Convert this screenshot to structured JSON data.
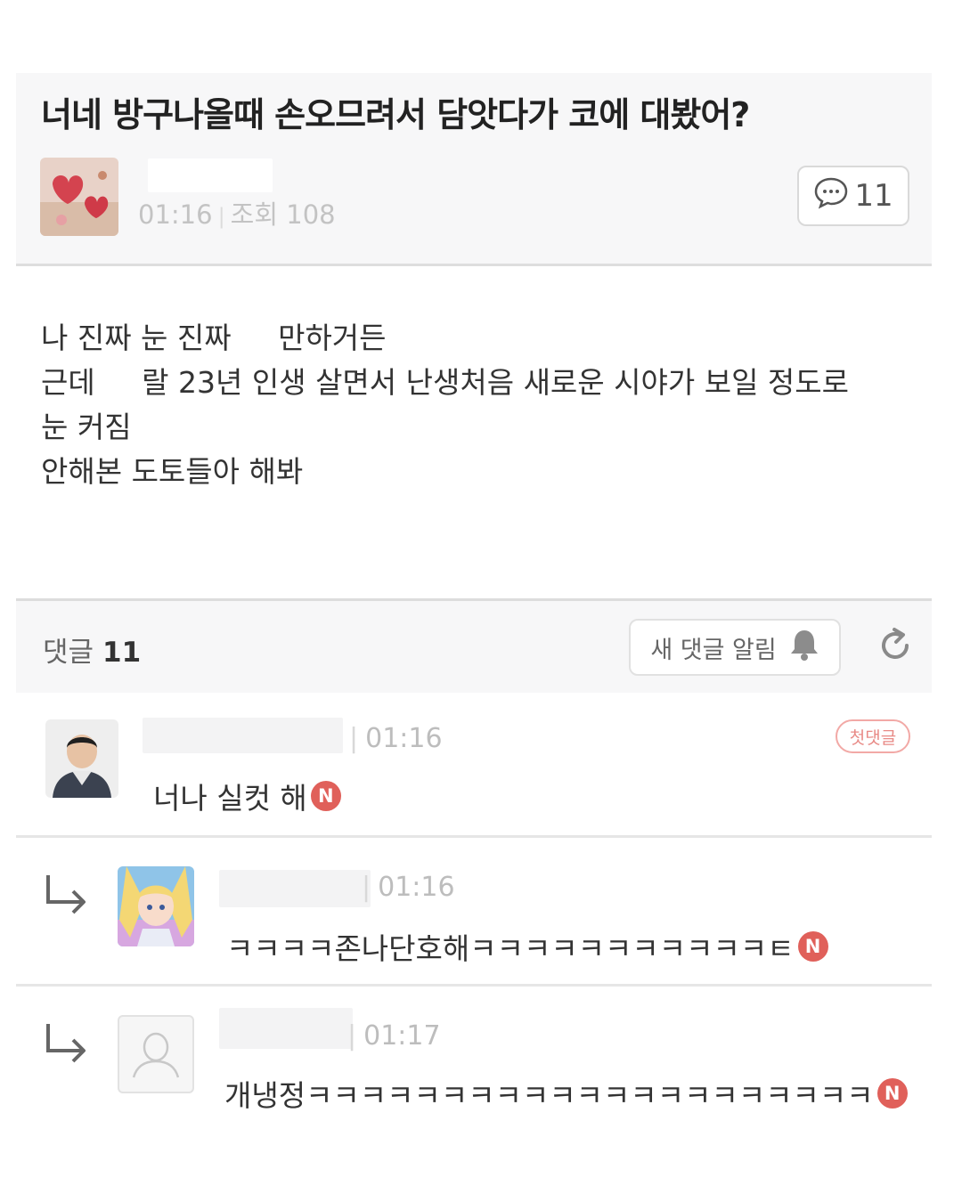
{
  "post": {
    "title": "너네 방구나올때 손오므려서 담앗다가 코에 대봤어?",
    "time": "01:16",
    "views_label": "조회 108",
    "comment_count": "11",
    "body_lines": [
      "나 진짜 눈 진짜     만하거든",
      "근데     랄 23년 인생 살면서 난생처음 새로운 시야가 보일 정도로",
      "눈 커짐",
      "안해본 도토들아 해봐"
    ]
  },
  "comments_header": {
    "label": "댓글",
    "count": "11",
    "notify_label": "새 댓글 알림"
  },
  "comments": [
    {
      "time": "01:16",
      "text": "너나 실컷 해",
      "badge": "N",
      "first_badge": "첫댓글"
    },
    {
      "time": "01:16",
      "text": "ㅋㅋㅋㅋ존나단호해ㅋㅋㅋㅋㅋㅋㅋㅋㅋㅋㅋㅌ",
      "badge": "N"
    },
    {
      "time": "01:17",
      "text": "개냉정ㅋㅋㅋㅋㅋㅋㅋㅋㅋㅋㅋㅋㅋㅋㅋㅋㅋㅋㅋㅋㅋ",
      "badge": "N"
    }
  ],
  "colors": {
    "panel_bg": "#f7f7f8",
    "new_badge": "#e0605a",
    "first_badge": "#e88a86",
    "meta_text": "#c3c3c3"
  },
  "icons": [
    "speech-bubble-icon",
    "bell-icon",
    "refresh-icon",
    "reply-arrow-icon",
    "default-profile-icon"
  ]
}
